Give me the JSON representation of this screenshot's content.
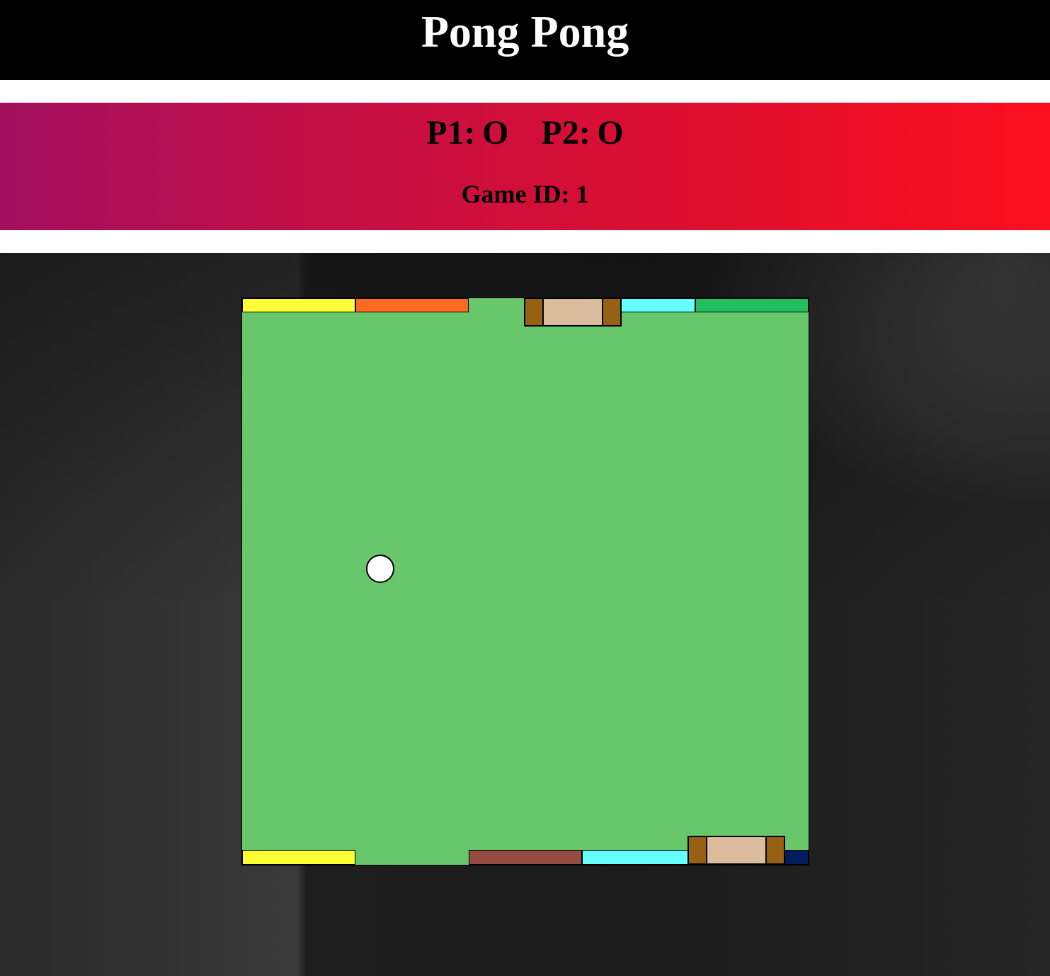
{
  "header": {
    "title": "Pong Pong"
  },
  "scoreboard": {
    "p1_label": "P1:",
    "p1_score": "O",
    "p2_label": "P2:",
    "p2_score": "O",
    "game_id_label": "Game ID:",
    "game_id": "1"
  },
  "colors": {
    "field": "#68c66b",
    "paddle_body": "#dbbc9d",
    "paddle_cap": "#976113",
    "ball": "#ffffff",
    "header_bg": "#000000",
    "scorebar_gradient": [
      "#a30f5e",
      "#fb0f1e"
    ]
  },
  "bricks": {
    "top": [
      "#ffff33",
      "#ff6a22",
      "#66ffff",
      "#22be5e"
    ],
    "bottom": [
      "#ffff33",
      "#974c43",
      "#66ffff",
      "#021b5a"
    ]
  }
}
